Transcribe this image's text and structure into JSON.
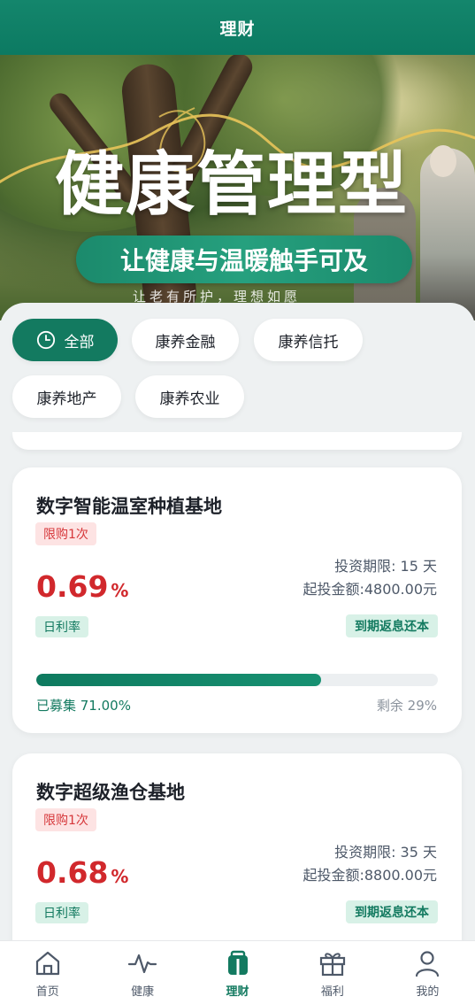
{
  "header": {
    "title": "理财"
  },
  "banner": {
    "title": "健康管理型",
    "slogan": "让健康与温暖触手可及",
    "subtitle": "让老有所护，理想如愿"
  },
  "categories": [
    {
      "label": "全部",
      "active": true,
      "icon": "clock-icon"
    },
    {
      "label": "康养金融",
      "active": false
    },
    {
      "label": "康养信托",
      "active": false
    },
    {
      "label": "康养地产",
      "active": false
    },
    {
      "label": "康养农业",
      "active": false
    }
  ],
  "products": [
    {
      "name": "数字智能温室种植基地",
      "limit": "限购1次",
      "rate": "0.69",
      "rate_unit": "%",
      "rate_label": "日利率",
      "term": "投资期限: 15 天",
      "min_amount": "起投金额:4800.00元",
      "repay": "到期返息还本",
      "raised": "已募集 71.00%",
      "remaining": "剩余 29%",
      "progress": 0.71
    },
    {
      "name": "数字超级渔仓基地",
      "limit": "限购1次",
      "rate": "0.68",
      "rate_unit": "%",
      "rate_label": "日利率",
      "term": "投资期限: 35 天",
      "min_amount": "起投金额:8800.00元",
      "repay": "到期返息还本"
    }
  ],
  "nav": [
    {
      "label": "首页",
      "icon": "home-icon"
    },
    {
      "label": "健康",
      "icon": "pulse-icon"
    },
    {
      "label": "理财",
      "icon": "wallet-icon",
      "active": true
    },
    {
      "label": "福利",
      "icon": "gift-icon"
    },
    {
      "label": "我的",
      "icon": "user-icon"
    }
  ],
  "colors": {
    "brand": "#137a60",
    "rate": "#d1282c"
  }
}
